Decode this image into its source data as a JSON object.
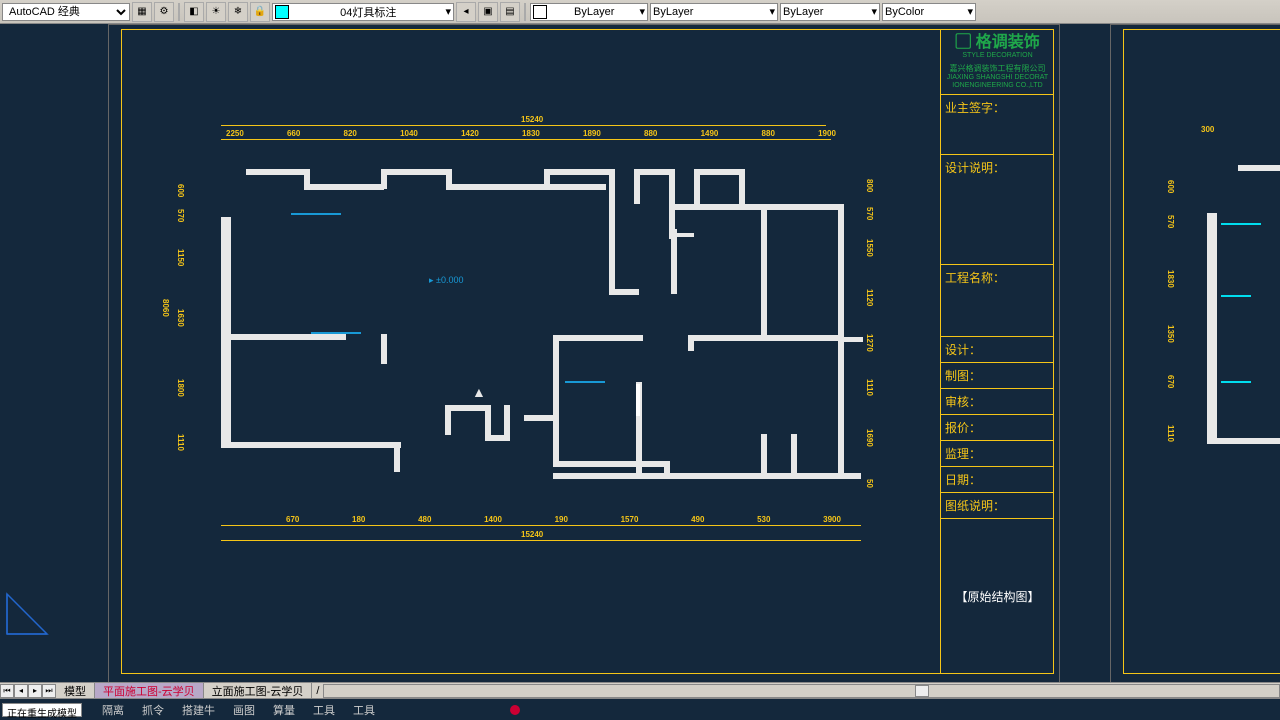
{
  "toolbar": {
    "workspace": "AutoCAD 经典",
    "layer": "04灯具标注",
    "color": "ByLayer",
    "linetype": "ByLayer",
    "lineweight": "ByLayer",
    "plotstyle": "ByColor"
  },
  "titleblock": {
    "logo_cn": "格调装饰",
    "logo_en": "STYLE DECORATION",
    "company1": "嘉兴格调装饰工程有限公司",
    "company2": "JIAXING SHANGSHI DECORAT",
    "company3": "IONENGINEERING CO.,LTD",
    "owner_sign": "业主签字：",
    "design_note": "设计说明：",
    "project_name": "工程名称：",
    "designer": "设计：",
    "drafter": "制图：",
    "reviewer": "审核：",
    "quoter": "报价：",
    "supervisor": "监理：",
    "date": "日期：",
    "dwg_note": "图纸说明：",
    "dwg_title": "【原始结构图】"
  },
  "dimensions": {
    "top_total": "15240",
    "top": [
      "2250",
      "660",
      "820",
      "1040",
      "1420",
      "1830",
      "1890",
      "880",
      "1490",
      "880",
      "1900"
    ],
    "bottom_total": "15240",
    "bottom": [
      "670",
      "180",
      "480",
      "1400",
      "190",
      "1570",
      "490",
      "530",
      "3900"
    ],
    "left": [
      "8060",
      "600",
      "570",
      "1150",
      "1630",
      "1800",
      "1110"
    ],
    "right": [
      "800",
      "570",
      "1550",
      "1120",
      "1270",
      "1110",
      "1690",
      "50"
    ],
    "level": "±0.000"
  },
  "tabs": {
    "model": "模型",
    "layout1": "平面施工图-云学贝",
    "layout2": "立面施工图-云学贝"
  },
  "status": {
    "cmd": "正在重生成模型",
    "menu": [
      "隔离",
      "抓令",
      "搭建牛",
      "画图",
      "算量",
      "工具",
      "工具"
    ]
  }
}
